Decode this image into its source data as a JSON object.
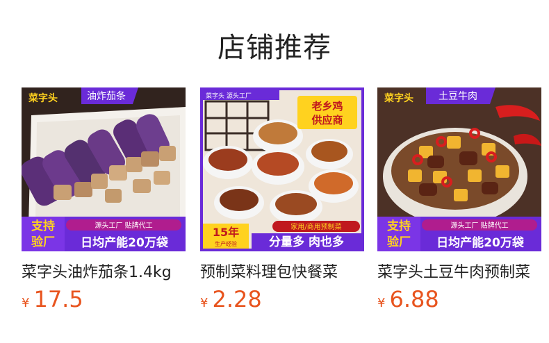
{
  "section": {
    "title": "店铺推荐"
  },
  "currency": "¥",
  "products": [
    {
      "name": "菜字头油炸茄条1.4kg",
      "price": "17.5",
      "image": {
        "brand": "菜字头",
        "tag": "油炸茄条",
        "badge_line1": "支持",
        "badge_line2": "验厂",
        "ribbon": "源头工厂 贴牌代工",
        "capacity": "日均产能20万袋"
      }
    },
    {
      "name": "预制菜料理包快餐菜",
      "price": "2.28",
      "image": {
        "brand": "菜字头 源头工厂",
        "tag_line1": "老乡鸡",
        "tag_line2": "供应商",
        "years": "15年",
        "years_sub": "生产经验",
        "ribbon": "家用/商用预制菜",
        "slogan": "分量多 肉也多"
      }
    },
    {
      "name": "菜字头土豆牛肉预制菜",
      "price": "6.88",
      "image": {
        "brand": "菜字头",
        "tag": "土豆牛肉",
        "badge_line1": "支持",
        "badge_line2": "验厂",
        "ribbon": "源头工厂 贴牌代工",
        "capacity": "日均产能20万袋"
      }
    }
  ],
  "colors": {
    "price": "#e8541e",
    "banner_purple": "#6a2bd8",
    "badge_yellow": "#ffd21f"
  }
}
